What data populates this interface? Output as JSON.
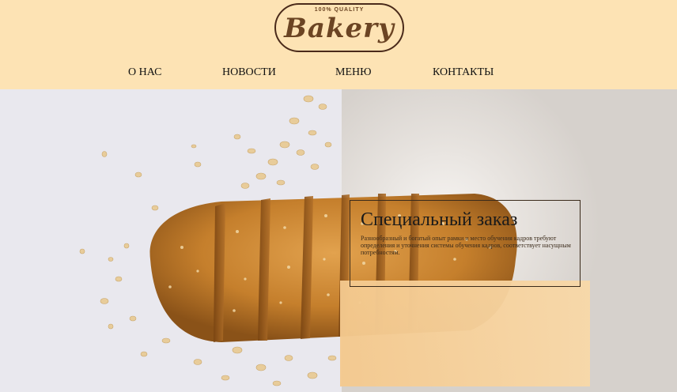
{
  "logo": {
    "quality": "100% QUALITY",
    "name": "Bakery"
  },
  "nav": {
    "items": [
      {
        "label": "О НАС"
      },
      {
        "label": "НОВОСТИ"
      },
      {
        "label": "МЕНЮ"
      },
      {
        "label": "КОНТАКТЫ"
      }
    ]
  },
  "hero": {
    "image": "bread-image"
  },
  "card": {
    "title": "Специальный заказ",
    "text": "Разнообразный и богатый опыт рамки и место обучения кадров требуют определения и уточнения системы обучения кадров, соответствует насущным потребностям."
  },
  "colors": {
    "header_bg": "#fde3b4",
    "logo_brown": "#6b4423",
    "card_bg": "#f4c98e"
  }
}
